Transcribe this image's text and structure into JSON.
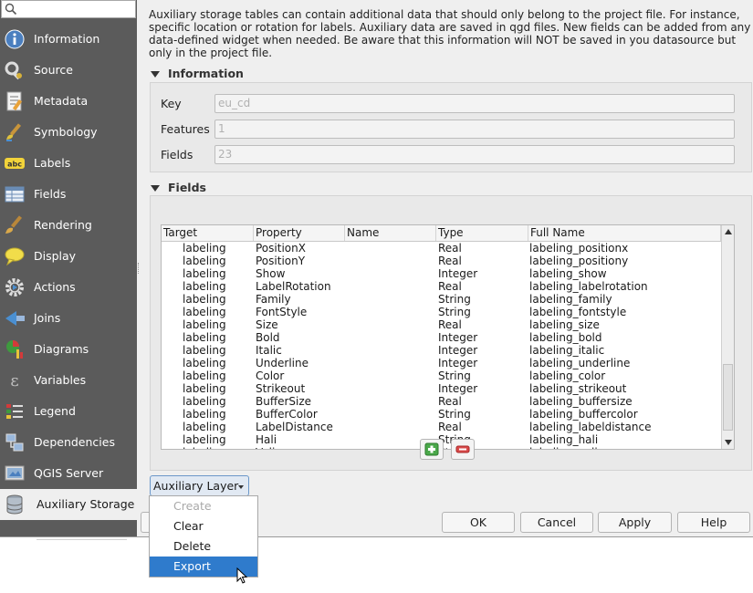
{
  "sidebar": {
    "items": [
      {
        "label": "Information",
        "icon": "info-icon"
      },
      {
        "label": "Source",
        "icon": "source-wrench-icon"
      },
      {
        "label": "Metadata",
        "icon": "metadata-icon"
      },
      {
        "label": "Symbology",
        "icon": "symbology-brush-icon"
      },
      {
        "label": "Labels",
        "icon": "labels-abc-icon"
      },
      {
        "label": "Fields",
        "icon": "fields-table-icon"
      },
      {
        "label": "Rendering",
        "icon": "rendering-brush-icon"
      },
      {
        "label": "Display",
        "icon": "display-speech-icon"
      },
      {
        "label": "Actions",
        "icon": "actions-gear-icon"
      },
      {
        "label": "Joins",
        "icon": "joins-icon"
      },
      {
        "label": "Diagrams",
        "icon": "diagrams-icon"
      },
      {
        "label": "Variables",
        "icon": "variables-epsilon-icon"
      },
      {
        "label": "Legend",
        "icon": "legend-icon"
      },
      {
        "label": "Dependencies",
        "icon": "dependencies-icon"
      },
      {
        "label": "QGIS Server",
        "icon": "qgis-server-icon"
      },
      {
        "label": "Auxiliary Storage",
        "icon": "auxiliary-storage-icon",
        "active": true
      }
    ]
  },
  "intro_text": "Auxiliary storage tables can contain additional data that should only belong to the project file. For instance, specific location or rotation for labels. Auxiliary data are saved in qgd files. New fields can be added from any data-defined widget when needed. Be aware that this information will NOT be saved in you datasource but only in the project file.",
  "information": {
    "title": "Information",
    "key_label": "Key",
    "key_value": "eu_cd",
    "features_label": "Features",
    "features_value": "1",
    "fields_label": "Fields",
    "fields_value": "23"
  },
  "fields_group": {
    "title": "Fields",
    "columns": [
      "Target",
      "Property",
      "Name",
      "Type",
      "Full Name"
    ],
    "rows": [
      [
        "labeling",
        "PositionX",
        "",
        "Real",
        "labeling_positionx"
      ],
      [
        "labeling",
        "PositionY",
        "",
        "Real",
        "labeling_positiony"
      ],
      [
        "labeling",
        "Show",
        "",
        "Integer",
        "labeling_show"
      ],
      [
        "labeling",
        "LabelRotation",
        "",
        "Real",
        "labeling_labelrotation"
      ],
      [
        "labeling",
        "Family",
        "",
        "String",
        "labeling_family"
      ],
      [
        "labeling",
        "FontStyle",
        "",
        "String",
        "labeling_fontstyle"
      ],
      [
        "labeling",
        "Size",
        "",
        "Real",
        "labeling_size"
      ],
      [
        "labeling",
        "Bold",
        "",
        "Integer",
        "labeling_bold"
      ],
      [
        "labeling",
        "Italic",
        "",
        "Integer",
        "labeling_italic"
      ],
      [
        "labeling",
        "Underline",
        "",
        "Integer",
        "labeling_underline"
      ],
      [
        "labeling",
        "Color",
        "",
        "String",
        "labeling_color"
      ],
      [
        "labeling",
        "Strikeout",
        "",
        "Integer",
        "labeling_strikeout"
      ],
      [
        "labeling",
        "BufferSize",
        "",
        "Real",
        "labeling_buffersize"
      ],
      [
        "labeling",
        "BufferColor",
        "",
        "String",
        "labeling_buffercolor"
      ],
      [
        "labeling",
        "LabelDistance",
        "",
        "Real",
        "labeling_labeldistance"
      ],
      [
        "labeling",
        "Hali",
        "",
        "String",
        "labeling_hali"
      ],
      [
        "labeling",
        "Vali",
        "",
        "String",
        "labeling_vali"
      ]
    ]
  },
  "aux_layer_button": "Auxiliary Layer",
  "menu": [
    {
      "label": "Create",
      "disabled": true
    },
    {
      "label": "Clear"
    },
    {
      "label": "Delete"
    },
    {
      "label": "Export",
      "hover": true
    }
  ],
  "buttons": {
    "ok": "OK",
    "cancel": "Cancel",
    "apply": "Apply",
    "help": "Help"
  },
  "colors": {
    "sidebar_bg": "#5b5b5b",
    "selection": "#2f7bcc",
    "remove_red": "#d33a3a",
    "add_green": "#3d9a3d"
  }
}
